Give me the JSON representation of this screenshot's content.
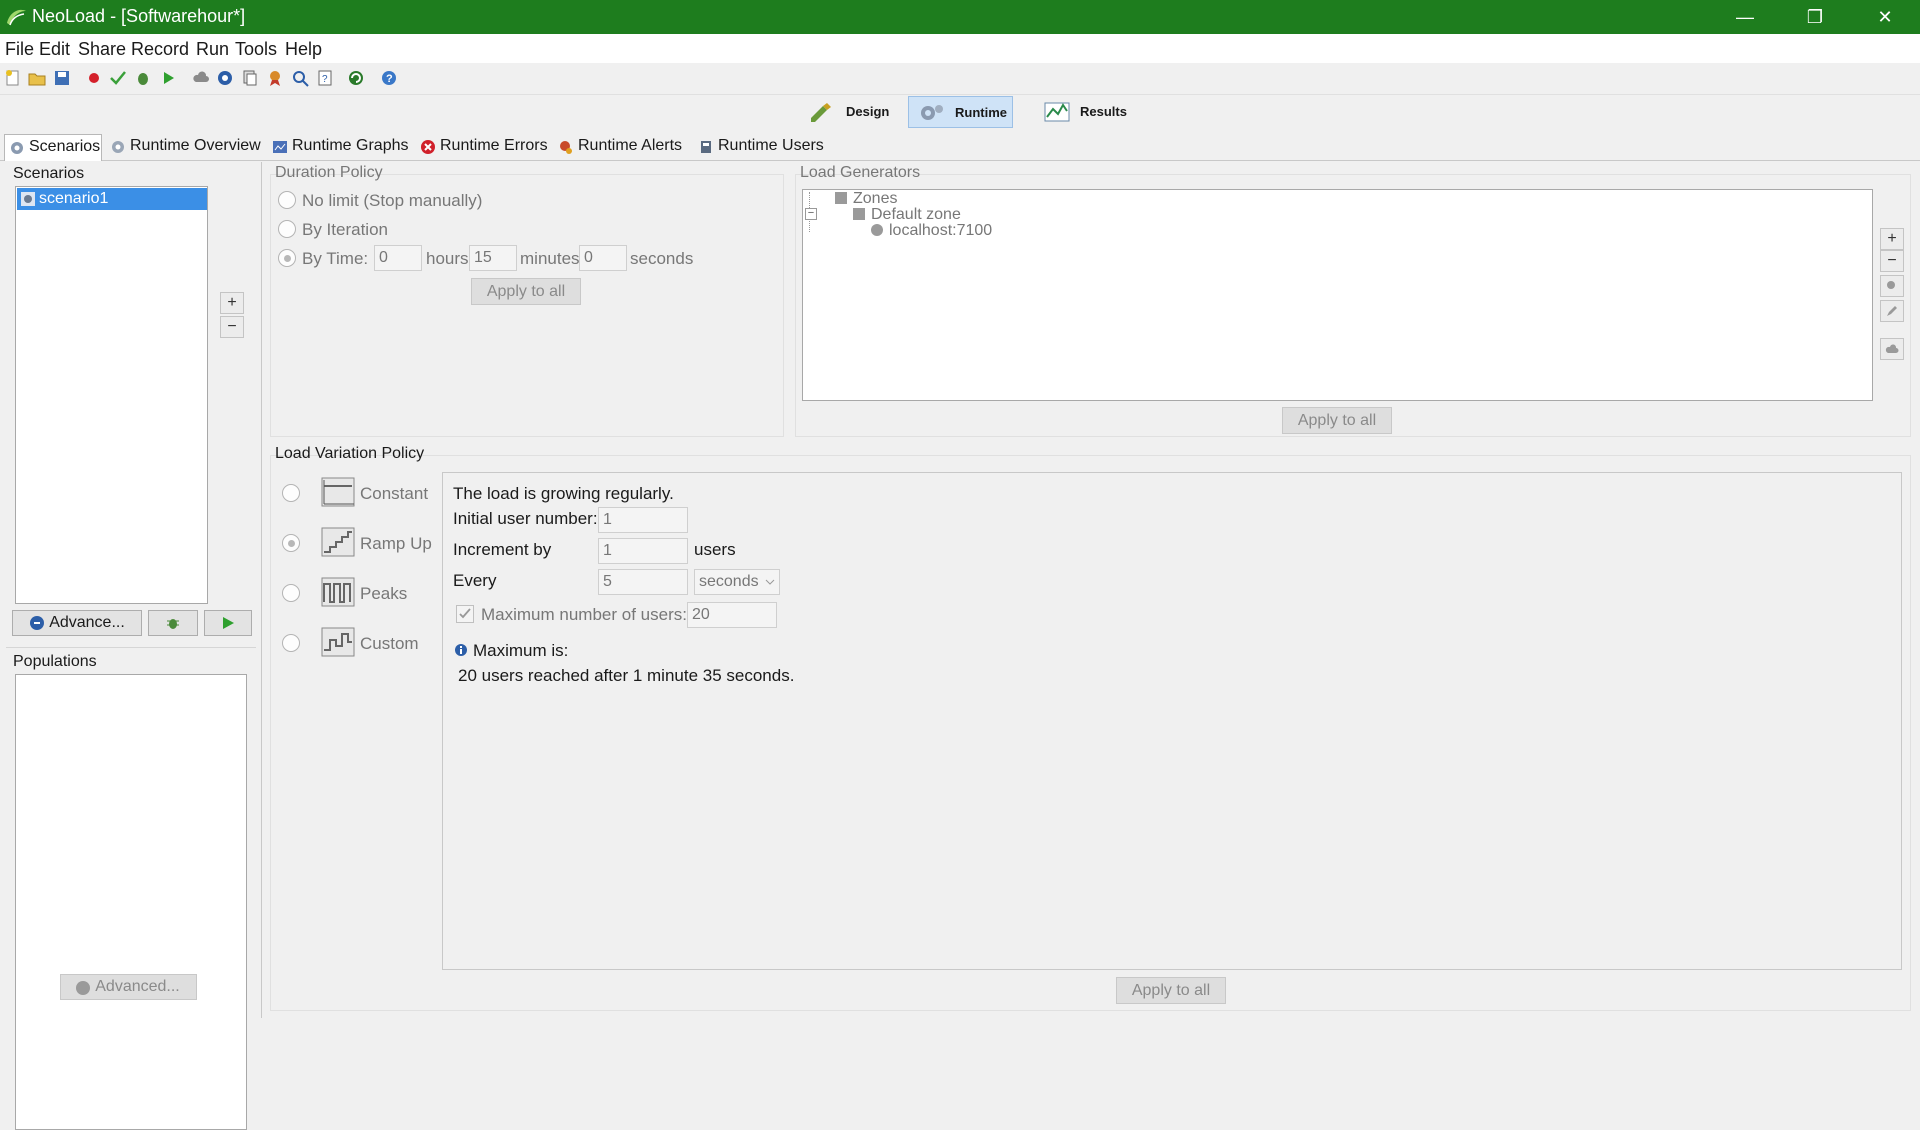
{
  "window": {
    "title": "NeoLoad - [Softwarehour*]",
    "minimize": "—",
    "restore": "❐",
    "close": "✕"
  },
  "menu": [
    "File",
    "Edit",
    "Share",
    "Record",
    "Run",
    "Tools",
    "Help"
  ],
  "toolbar_icons": [
    "new-project-icon",
    "open-project-icon",
    "save-icon",
    "record-icon",
    "check-icon",
    "bug-icon",
    "play-icon",
    "cloud-icon",
    "globe-icon",
    "copy-icon",
    "certificate-icon",
    "search-icon",
    "help-doc-icon",
    "refresh-icon",
    "help-icon"
  ],
  "perspectives": {
    "design": "Design",
    "runtime": "Runtime",
    "results": "Results"
  },
  "tabs": [
    "Scenarios",
    "Runtime Overview",
    "Runtime Graphs",
    "Runtime Errors",
    "Runtime Alerts",
    "Runtime Users"
  ],
  "scenarios": {
    "label": "Scenarios",
    "items": [
      "scenario1"
    ],
    "add": "+",
    "remove": "−",
    "advance_button": "Advance...",
    "populations_label": "Populations",
    "advanced_button": "Advanced..."
  },
  "duration": {
    "label": "Duration Policy",
    "no_limit": "No limit (Stop manually)",
    "by_iteration": "By Iteration",
    "by_time": "By Time:",
    "hours_value": "0",
    "hours_label": "hours",
    "minutes_value": "15",
    "minutes_label": "minutes",
    "seconds_value": "0",
    "seconds_label": "seconds",
    "apply": "Apply to all"
  },
  "load_generators": {
    "label": "Load Generators",
    "tree": {
      "root": "Zones",
      "zone": "Default zone",
      "host": "localhost:7100"
    },
    "apply": "Apply to all"
  },
  "load_variation": {
    "label": "Load Variation Policy",
    "options": [
      "Constant",
      "Ramp Up",
      "Peaks",
      "Custom"
    ],
    "description": "The load is growing regularly.",
    "initial_label": "Initial user number:",
    "initial_value": "1",
    "increment_label": "Increment by",
    "increment_value": "1",
    "increment_unit": "users",
    "every_label": "Every",
    "every_value": "5",
    "every_unit": "seconds",
    "max_label": "Maximum number of users:",
    "max_value": "20",
    "maximum_is": "Maximum is:",
    "summary": "20 users reached after 1 minute 35 seconds.",
    "apply": "Apply to all"
  }
}
